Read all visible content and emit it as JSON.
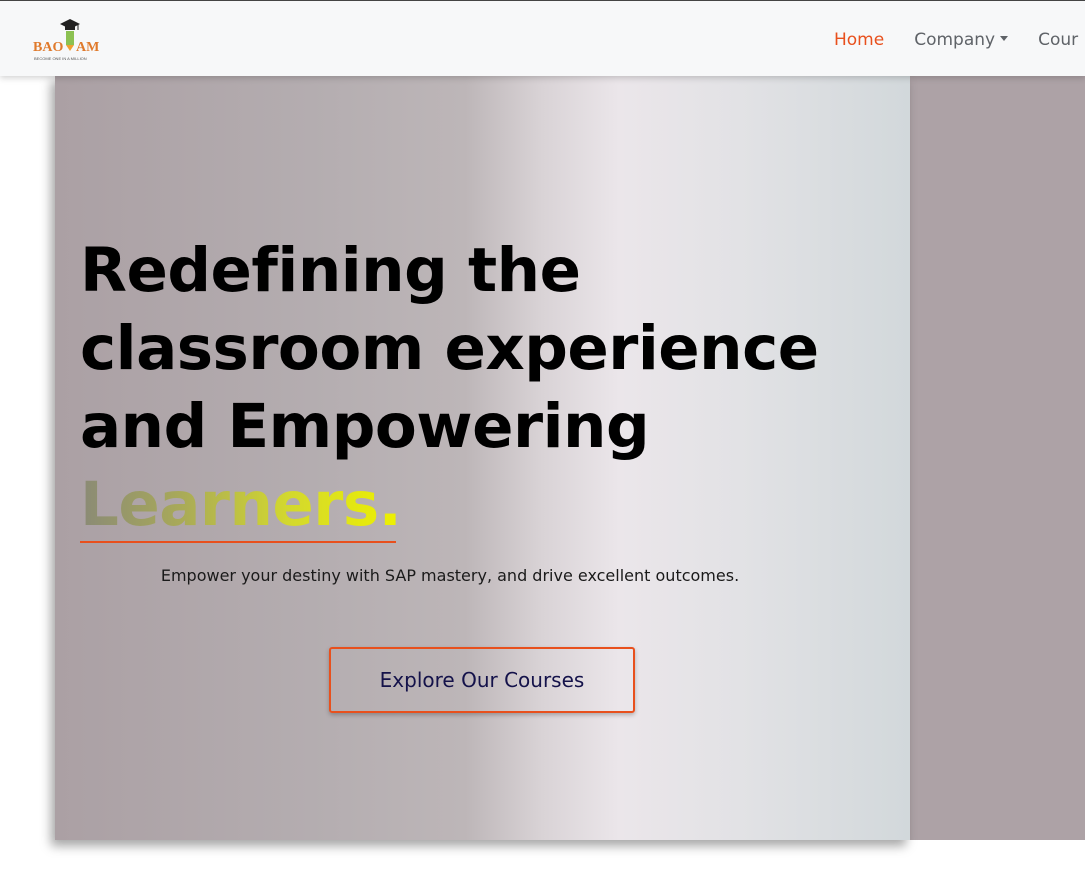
{
  "brand": {
    "logo_text": "BAOVAM",
    "logo_tagline": "BECOME ONE IN A MILLION"
  },
  "nav": {
    "items": [
      {
        "label": "Home"
      },
      {
        "label": "Company"
      },
      {
        "label": "Cour"
      }
    ]
  },
  "hero": {
    "headline_lines": [
      "Redefining the",
      "classroom experience",
      "and Empowering"
    ],
    "headline_highlight": "Learners.",
    "subtitle": "Empower your destiny with SAP mastery, and drive excellent outcomes.",
    "cta_label": "Explore Our Courses"
  },
  "colors": {
    "accent": "#e8501d",
    "cta_text": "#14124a",
    "nav_text": "#5f6368"
  },
  "icons": [
    "graduation-cap-icon",
    "caret-down-icon"
  ]
}
